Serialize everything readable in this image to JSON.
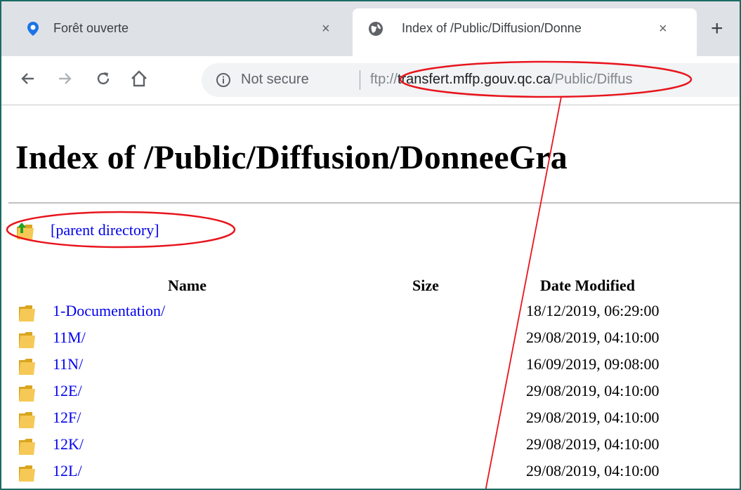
{
  "tabs": [
    {
      "title": "Forêt ouverte",
      "icon": "location-pin-icon",
      "active": false,
      "close": "×"
    },
    {
      "title": "Index of /Public/Diffusion/Donne",
      "icon": "globe-icon",
      "active": true,
      "close": "×"
    }
  ],
  "new_tab_label": "+",
  "toolbar": {
    "security_text": "Not secure",
    "url_scheme": "ftp://",
    "url_host": "transfert.mffp.gouv.qc.ca",
    "url_path": "/Public/Diffus"
  },
  "page": {
    "title": "Index of /Public/Diffusion/DonneeGra",
    "parent_link": "[parent directory]",
    "columns": {
      "name": "Name",
      "size": "Size",
      "date": "Date Modified"
    },
    "rows": [
      {
        "name": "1-Documentation/",
        "date": "18/12/2019, 06:29:00"
      },
      {
        "name": "11M/",
        "date": "29/08/2019, 04:10:00"
      },
      {
        "name": "11N/",
        "date": "16/09/2019, 09:08:00"
      },
      {
        "name": "12E/",
        "date": "29/08/2019, 04:10:00"
      },
      {
        "name": "12F/",
        "date": "29/08/2019, 04:10:00"
      },
      {
        "name": "12K/",
        "date": "29/08/2019, 04:10:00"
      },
      {
        "name": "12L/",
        "date": "29/08/2019, 04:10:00"
      }
    ]
  },
  "colors": {
    "annotation": "#e8141c",
    "link": "#0000ee",
    "frame": "#1b6b63",
    "tabstrip": "#dee1e6"
  }
}
